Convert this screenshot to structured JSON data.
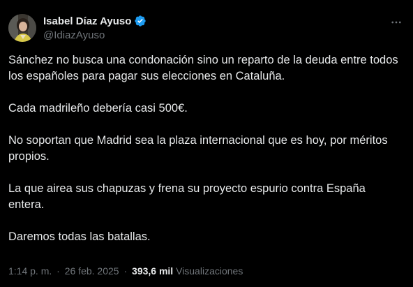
{
  "author": {
    "display_name": "Isabel Díaz Ayuso",
    "handle": "@IdiazAyuso",
    "verified": true,
    "avatar_icon": "profile-photo"
  },
  "tweet": {
    "paragraphs": [
      "Sánchez no busca una condonación sino un reparto de la deuda entre todos los españoles para pagar sus elecciones en Cataluña.",
      "Cada madrileño debería casi 500€.",
      "No soportan que Madrid sea la plaza internacional que es hoy, por méritos propios.",
      "La que airea sus chapuzas y frena su proyecto espurio contra España entera.",
      "Daremos todas las batallas."
    ]
  },
  "meta": {
    "time": "1:14 p. m.",
    "date": "26 feb. 2025",
    "separator": "·",
    "views_count": "393,6 mil",
    "views_label": "Visualizaciones"
  },
  "colors": {
    "background": "#000000",
    "text": "#e7e9ea",
    "secondary": "#71767b",
    "verified": "#1d9bf0"
  }
}
